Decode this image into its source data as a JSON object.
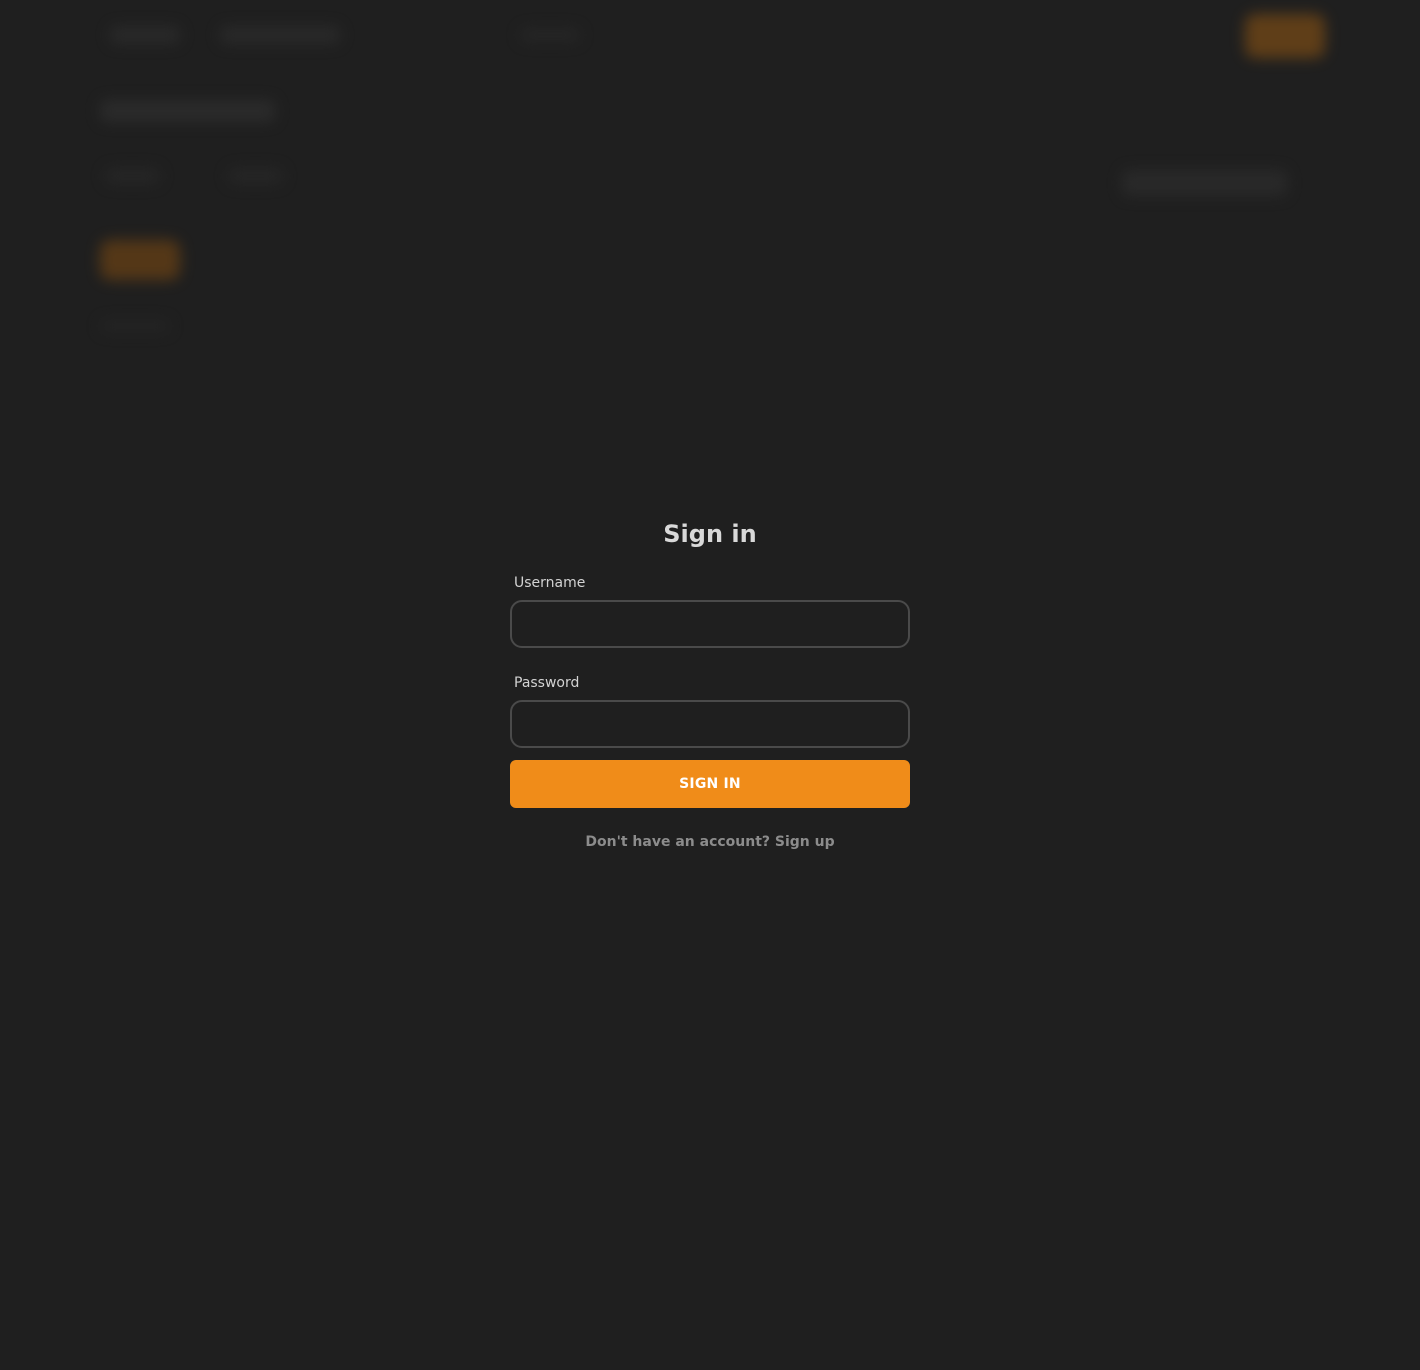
{
  "signin": {
    "title": "Sign in",
    "username_label": "Username",
    "username_value": "",
    "password_label": "Password",
    "password_value": "",
    "submit_label": "SIGN IN",
    "signup_prompt": "Don't have an account?",
    "signup_link": "Sign up"
  },
  "colors": {
    "background": "#1f1f1f",
    "accent": "#f08c19",
    "input_border": "#4a4a4a",
    "title_text": "#d9d9d9",
    "muted_text": "#8c8c8c"
  }
}
